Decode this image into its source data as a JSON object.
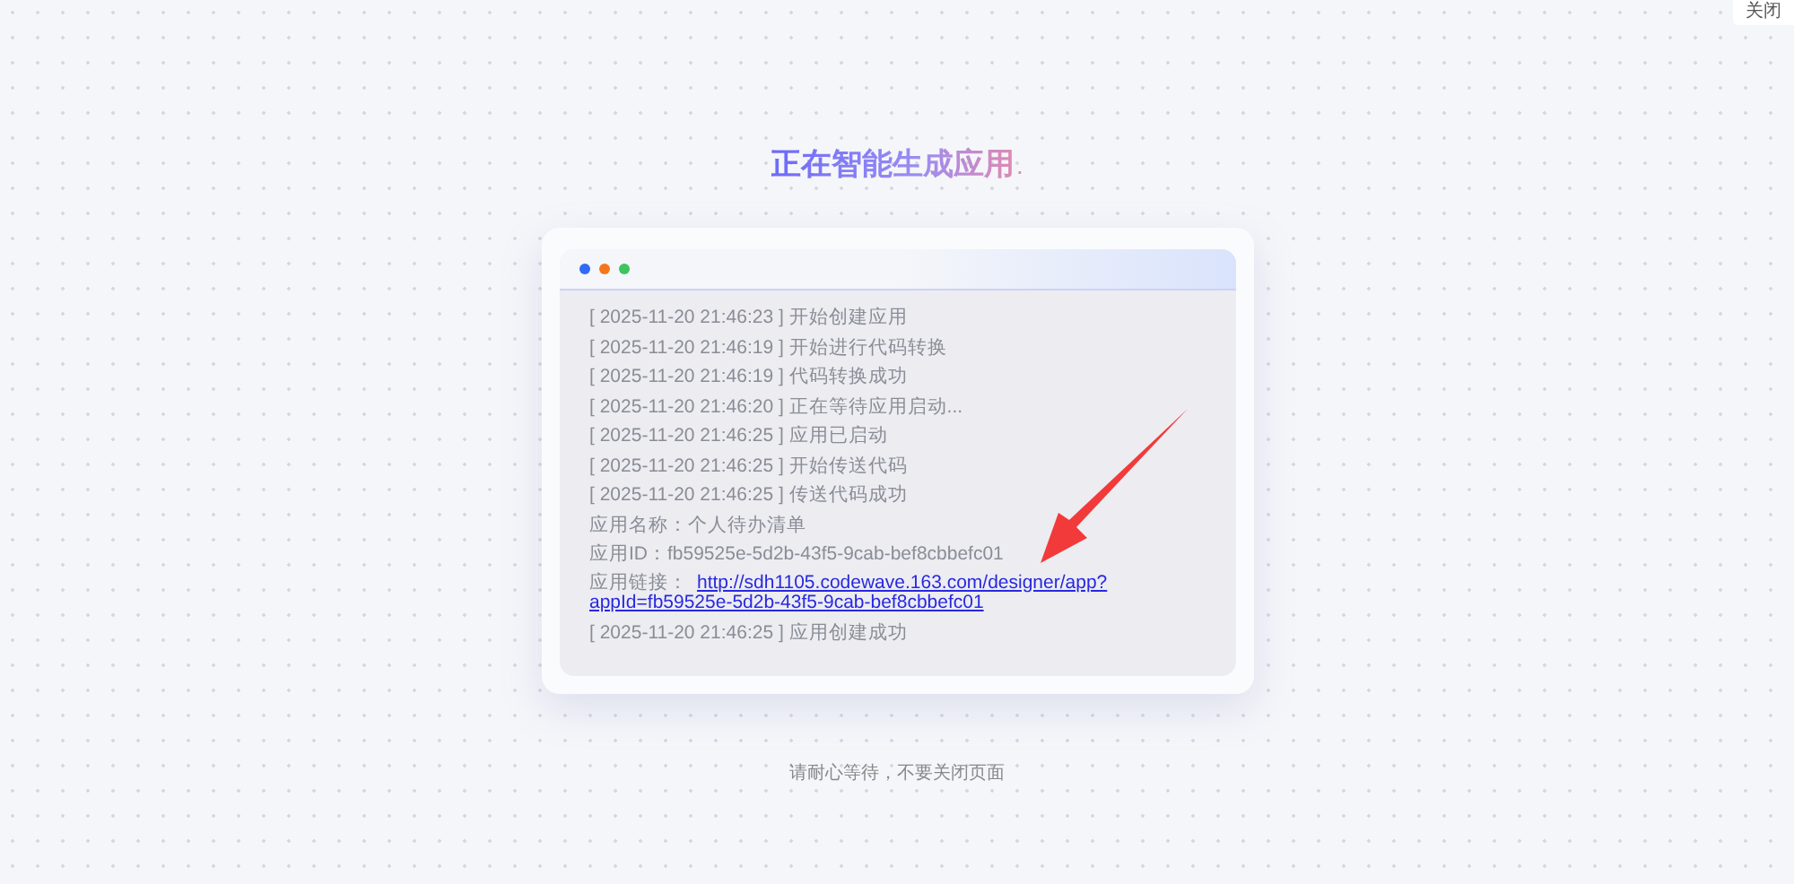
{
  "close_button": {
    "label": "关闭"
  },
  "title": "正在智能生成应用",
  "title_dots": ".",
  "log": [
    {
      "kind": "log",
      "time": "[ 2025-11-20 21:46:23 ]",
      "text": "开始创建应用"
    },
    {
      "kind": "log",
      "time": "[ 2025-11-20 21:46:19 ]",
      "text": "开始进行代码转换"
    },
    {
      "kind": "log",
      "time": "[ 2025-11-20 21:46:19 ]",
      "text": "代码转换成功"
    },
    {
      "kind": "log",
      "time": "[ 2025-11-20 21:46:20 ]",
      "text": "正在等待应用启动..."
    },
    {
      "kind": "log",
      "time": "[ 2025-11-20 21:46:25 ]",
      "text": "应用已启动"
    },
    {
      "kind": "log",
      "time": "[ 2025-11-20 21:46:25 ]",
      "text": "开始传送代码"
    },
    {
      "kind": "log",
      "time": "[ 2025-11-20 21:46:25 ]",
      "text": "传送代码成功"
    },
    {
      "kind": "field",
      "label": "应用名称：",
      "text": "个人待办清单"
    },
    {
      "kind": "field",
      "label": "应用ID：",
      "text": "fb59525e-5d2b-43f5-9cab-bef8cbbefc01"
    },
    {
      "kind": "link",
      "label": "应用链接：",
      "lines": [
        "http://sdh1105.codewave.163.com/designer/app?",
        "appId=fb59525e-5d2b-43f5-9cab-bef8cbbefc01"
      ]
    },
    {
      "kind": "log",
      "time": "[ 2025-11-20 21:46:25 ]",
      "text": "应用创建成功"
    }
  ],
  "footer": "请耐心等待，不要关闭页面"
}
